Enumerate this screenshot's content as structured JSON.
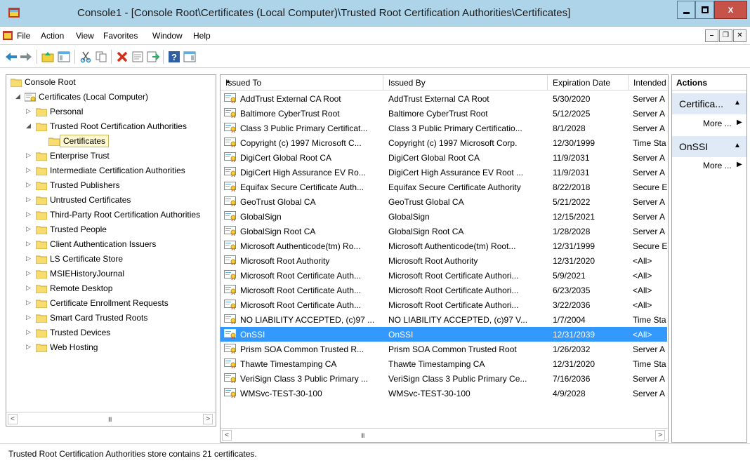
{
  "window": {
    "title": "Console1 - [Console Root\\Certificates (Local Computer)\\Trusted Root Certification Authorities\\Certificates]",
    "minimize_glyph": "",
    "close_glyph": "x"
  },
  "menu": {
    "items": [
      "File",
      "Action",
      "View",
      "Favorites",
      "Window",
      "Help"
    ],
    "mdi": [
      "–",
      "❐",
      "✕"
    ]
  },
  "toolbar": {
    "buttons": [
      "back-icon",
      "forward-icon",
      "up-folder-icon",
      "show-hide-tree-icon",
      "cut-icon",
      "copy-icon",
      "delete-icon",
      "properties-icon",
      "export-icon",
      "help-icon",
      "show-hide-action-pane-icon"
    ]
  },
  "tree": {
    "root": "Console Root",
    "computer": "Certificates (Local Computer)",
    "items": [
      {
        "label": "Personal",
        "expanded": false
      },
      {
        "label": "Trusted Root Certification Authorities",
        "expanded": true
      },
      {
        "label": "Certificates",
        "child": true
      },
      {
        "label": "Enterprise Trust",
        "expanded": false
      },
      {
        "label": "Intermediate Certification Authorities",
        "expanded": false
      },
      {
        "label": "Trusted Publishers",
        "expanded": false
      },
      {
        "label": "Untrusted Certificates",
        "expanded": false
      },
      {
        "label": "Third-Party Root Certification Authorities",
        "expanded": false
      },
      {
        "label": "Trusted People",
        "expanded": false
      },
      {
        "label": "Client Authentication Issuers",
        "expanded": false
      },
      {
        "label": "LS Certificate Store",
        "expanded": false
      },
      {
        "label": "MSIEHistoryJournal",
        "expanded": false
      },
      {
        "label": "Remote Desktop",
        "expanded": false
      },
      {
        "label": "Certificate Enrollment Requests",
        "expanded": false
      },
      {
        "label": "Smart Card Trusted Roots",
        "expanded": false
      },
      {
        "label": "Trusted Devices",
        "expanded": false
      },
      {
        "label": "Web Hosting",
        "expanded": false
      }
    ],
    "scroll_grip": "III"
  },
  "list": {
    "columns": [
      "Issued To",
      "Issued By",
      "Expiration Date",
      "Intended Purposes"
    ],
    "rows": [
      [
        "AddTrust External CA Root",
        "AddTrust External CA Root",
        "5/30/2020",
        "Server A"
      ],
      [
        "Baltimore CyberTrust Root",
        "Baltimore CyberTrust Root",
        "5/12/2025",
        "Server A"
      ],
      [
        "Class 3 Public Primary Certificat...",
        "Class 3 Public Primary Certificatio...",
        "8/1/2028",
        "Server A"
      ],
      [
        "Copyright (c) 1997 Microsoft C...",
        "Copyright (c) 1997 Microsoft Corp.",
        "12/30/1999",
        "Time Sta"
      ],
      [
        "DigiCert Global Root CA",
        "DigiCert Global Root CA",
        "11/9/2031",
        "Server A"
      ],
      [
        "DigiCert High Assurance EV Ro...",
        "DigiCert High Assurance EV Root ...",
        "11/9/2031",
        "Server A"
      ],
      [
        "Equifax Secure Certificate Auth...",
        "Equifax Secure Certificate Authority",
        "8/22/2018",
        "Secure E"
      ],
      [
        "GeoTrust Global CA",
        "GeoTrust Global CA",
        "5/21/2022",
        "Server A"
      ],
      [
        "GlobalSign",
        "GlobalSign",
        "12/15/2021",
        "Server A"
      ],
      [
        "GlobalSign Root CA",
        "GlobalSign Root CA",
        "1/28/2028",
        "Server A"
      ],
      [
        "Microsoft Authenticode(tm) Ro...",
        "Microsoft Authenticode(tm) Root...",
        "12/31/1999",
        "Secure E"
      ],
      [
        "Microsoft Root Authority",
        "Microsoft Root Authority",
        "12/31/2020",
        "<All>"
      ],
      [
        "Microsoft Root Certificate Auth...",
        "Microsoft Root Certificate Authori...",
        "5/9/2021",
        "<All>"
      ],
      [
        "Microsoft Root Certificate Auth...",
        "Microsoft Root Certificate Authori...",
        "6/23/2035",
        "<All>"
      ],
      [
        "Microsoft Root Certificate Auth...",
        "Microsoft Root Certificate Authori...",
        "3/22/2036",
        "<All>"
      ],
      [
        "NO LIABILITY ACCEPTED, (c)97 ...",
        "NO LIABILITY ACCEPTED, (c)97 V...",
        "1/7/2004",
        "Time Sta"
      ],
      [
        "OnSSI",
        "OnSSI",
        "12/31/2039",
        "<All>"
      ],
      [
        "Prism SOA Common Trusted R...",
        "Prism SOA Common Trusted Root",
        "1/26/2032",
        "Server A"
      ],
      [
        "Thawte Timestamping CA",
        "Thawte Timestamping CA",
        "12/31/2020",
        "Time Sta"
      ],
      [
        "VeriSign Class 3 Public Primary ...",
        "VeriSign Class 3 Public Primary Ce...",
        "7/16/2036",
        "Server A"
      ],
      [
        "WMSvc-TEST-30-100",
        "WMSvc-TEST-30-100",
        "4/9/2028",
        "Server A"
      ]
    ],
    "selected_index": 16,
    "scroll_grip": "III"
  },
  "actions": {
    "title": "Actions",
    "groups": [
      {
        "label": "Certifica...",
        "item": "More ..."
      },
      {
        "label": "OnSSI",
        "item": "More ..."
      }
    ]
  },
  "status": {
    "text": "Trusted Root Certification Authorities store contains 21 certificates."
  },
  "colors": {
    "titlebar": "#aed4ea",
    "selection": "#3399ff",
    "action_group": "#dfeaf6",
    "close_button": "#c7524a"
  }
}
